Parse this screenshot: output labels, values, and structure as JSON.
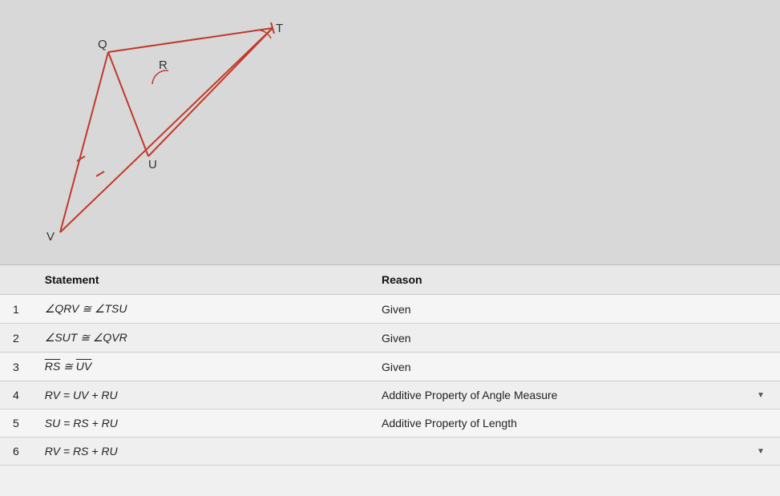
{
  "diagram": {
    "label_Q": "Q",
    "label_R": "R",
    "label_T": "T",
    "label_U": "U",
    "label_V": "V"
  },
  "table": {
    "col_statement": "Statement",
    "col_reason": "Reason",
    "rows": [
      {
        "num": "1",
        "statement": "∠QRV ≅ ∠TSU",
        "reason": "Given",
        "has_dropdown": false
      },
      {
        "num": "2",
        "statement": "∠SUT ≅ ∠QVR",
        "reason": "Given",
        "has_dropdown": false
      },
      {
        "num": "3",
        "statement_pre": "RS",
        "statement_post": "UV",
        "statement_type": "overline",
        "reason": "Given",
        "has_dropdown": false
      },
      {
        "num": "4",
        "statement": "RV = UV + RU",
        "reason": "Additive Property of Angle Measure",
        "has_dropdown": true
      },
      {
        "num": "5",
        "statement": "SU = RS + RU",
        "reason": "Additive Property of Length",
        "has_dropdown": false
      },
      {
        "num": "6",
        "statement": "RV = RS + RU",
        "reason": "",
        "has_dropdown": true
      }
    ]
  }
}
